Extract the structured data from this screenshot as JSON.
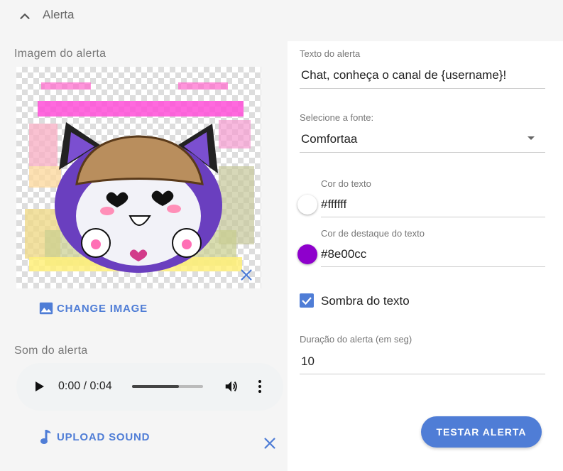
{
  "header": {
    "title": "Alerta",
    "icon": "chevron-up-icon"
  },
  "image_section": {
    "label": "Imagem do alerta",
    "change_label": "CHANGE IMAGE",
    "change_icon": "image-icon",
    "remove_icon": "close-icon"
  },
  "sound_section": {
    "label": "Som do alerta",
    "time": "0:00 / 0:04",
    "progress": 0.66,
    "upload_label": "UPLOAD SOUND",
    "upload_icon": "music-note-icon",
    "remove_icon": "close-icon"
  },
  "form": {
    "text_label": "Texto do alerta",
    "text_value": "Chat, conheça o canal de {username}!",
    "font_label": "Selecione a fonte:",
    "font_value": "Comfortaa",
    "text_color_label": "Cor do texto",
    "text_color_value": "#ffffff",
    "highlight_label": "Cor de destaque do texto",
    "highlight_value": "#8e00cc",
    "shadow_label": "Sombra do texto",
    "shadow_checked": true,
    "duration_label": "Duração do alerta (em seg)",
    "duration_value": "10"
  },
  "actions": {
    "test_label": "TESTAR ALERTA"
  },
  "colors": {
    "accent": "#4f7dd6",
    "text_color": "#ffffff",
    "highlight": "#8e00cc"
  }
}
